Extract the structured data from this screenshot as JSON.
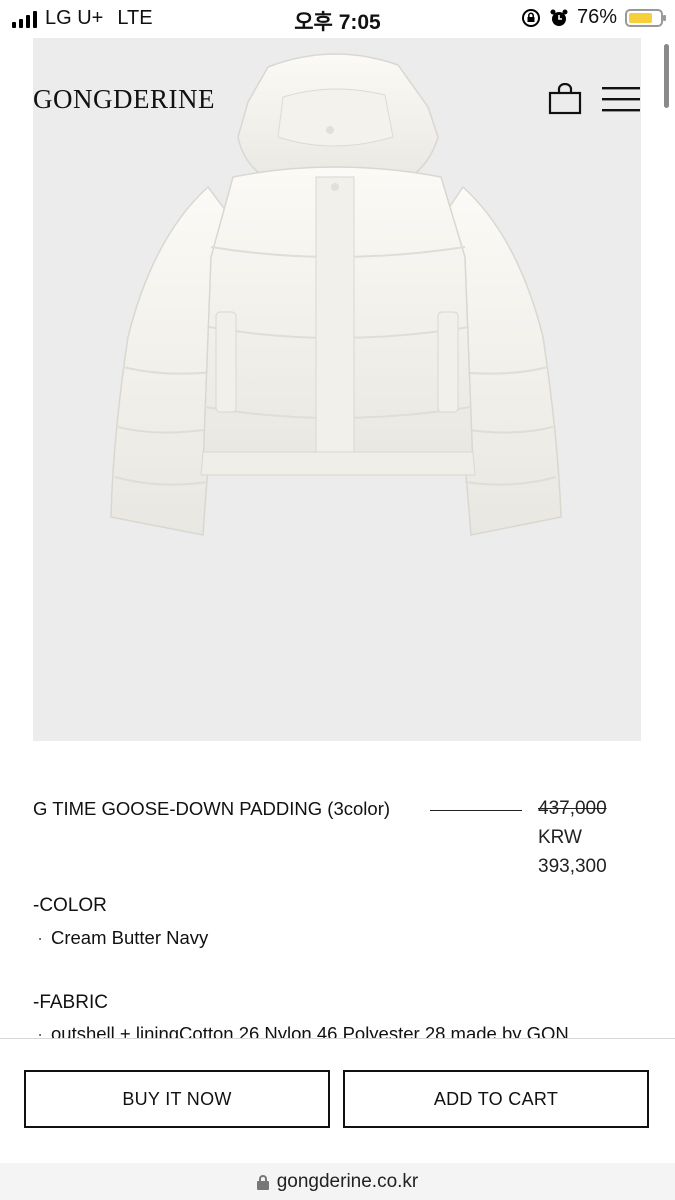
{
  "status_bar": {
    "carrier": "LG U+",
    "network": "LTE",
    "time": "오후 7:05",
    "battery": "76%",
    "battery_level": 0.76,
    "battery_color": "#f6cf3a"
  },
  "header": {
    "brand": "GONGDERINE",
    "cart_icon": "shopping-bag-icon",
    "menu_icon": "hamburger-menu-icon"
  },
  "product": {
    "image": "cream-puffer-jacket-image",
    "name": "G TIME GOOSE-DOWN PADDING (3color)",
    "original_price": "437,000",
    "currency": "KRW",
    "sale_price": "393,300"
  },
  "details": {
    "color_heading": "-COLOR",
    "color_bullet": "·",
    "colors": "Cream Butter Navy",
    "fabric_heading": "-FABRIC",
    "fabric_bullet": "·",
    "fabric": "outshell + liningCotton 26 Nylon 46 Polyester 28 made by GON"
  },
  "actions": {
    "buy_now": "BUY IT NOW",
    "add_to_cart": "ADD TO CART"
  },
  "browser": {
    "url": "gongderine.co.kr",
    "lock_icon": "lock-icon"
  }
}
